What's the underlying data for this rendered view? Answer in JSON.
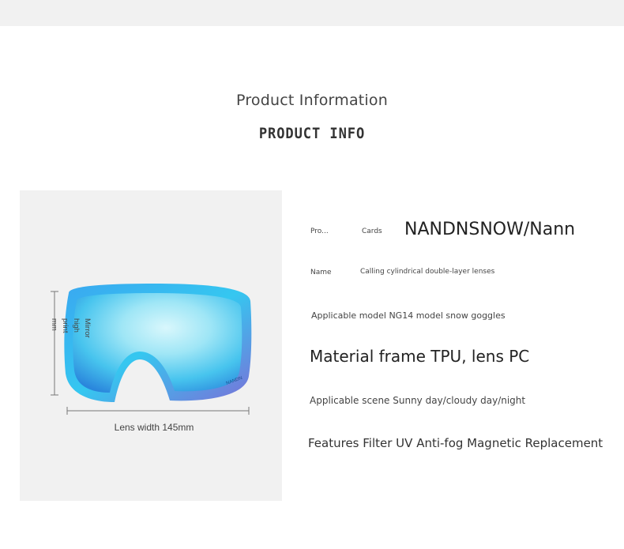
{
  "header": {
    "title_cn": "Product Information",
    "title_en": "PRODUCT INFO"
  },
  "image": {
    "height_label": "Mirror high print mm",
    "width_label": "Lens width 145mm",
    "lens_brand_mark": "NANDN",
    "lens_colors": [
      "#cdf3fb",
      "#5ed1f2",
      "#2a8fe0",
      "#7b6fd6"
    ]
  },
  "info": {
    "brand_label": "Pro...",
    "brand_key": "Cards",
    "brand_value": "NANDNSNOW/Nann",
    "name_label": "Name",
    "name_value": "Calling cylindrical double-layer lenses",
    "model": "Applicable model NG14 model snow goggles",
    "material": "Material frame TPU, lens PC",
    "scene": "Applicable scene Sunny day/cloudy day/night",
    "features": "Features Filter UV Anti-fog Magnetic Replacement"
  }
}
